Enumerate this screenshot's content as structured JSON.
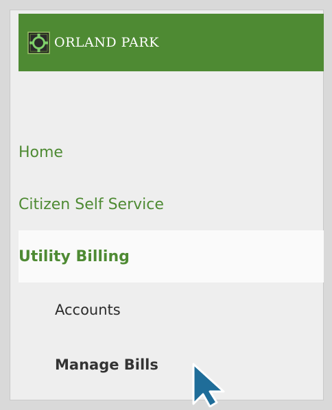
{
  "colors": {
    "header_bg": "#4e8a33",
    "nav_green": "#4e8a33",
    "active_bg": "#fafafa",
    "cursor_fill": "#1f6d99"
  },
  "header": {
    "brand": "ORLAND PARK",
    "logo_icon": "orland-park-logo"
  },
  "nav": {
    "home": "Home",
    "citizen_self_service": "Citizen Self Service",
    "utility_billing": "Utility Billing"
  },
  "subnav": {
    "accounts": "Accounts",
    "manage_bills": "Manage Bills"
  },
  "cursor_icon": "mouse-pointer-icon"
}
